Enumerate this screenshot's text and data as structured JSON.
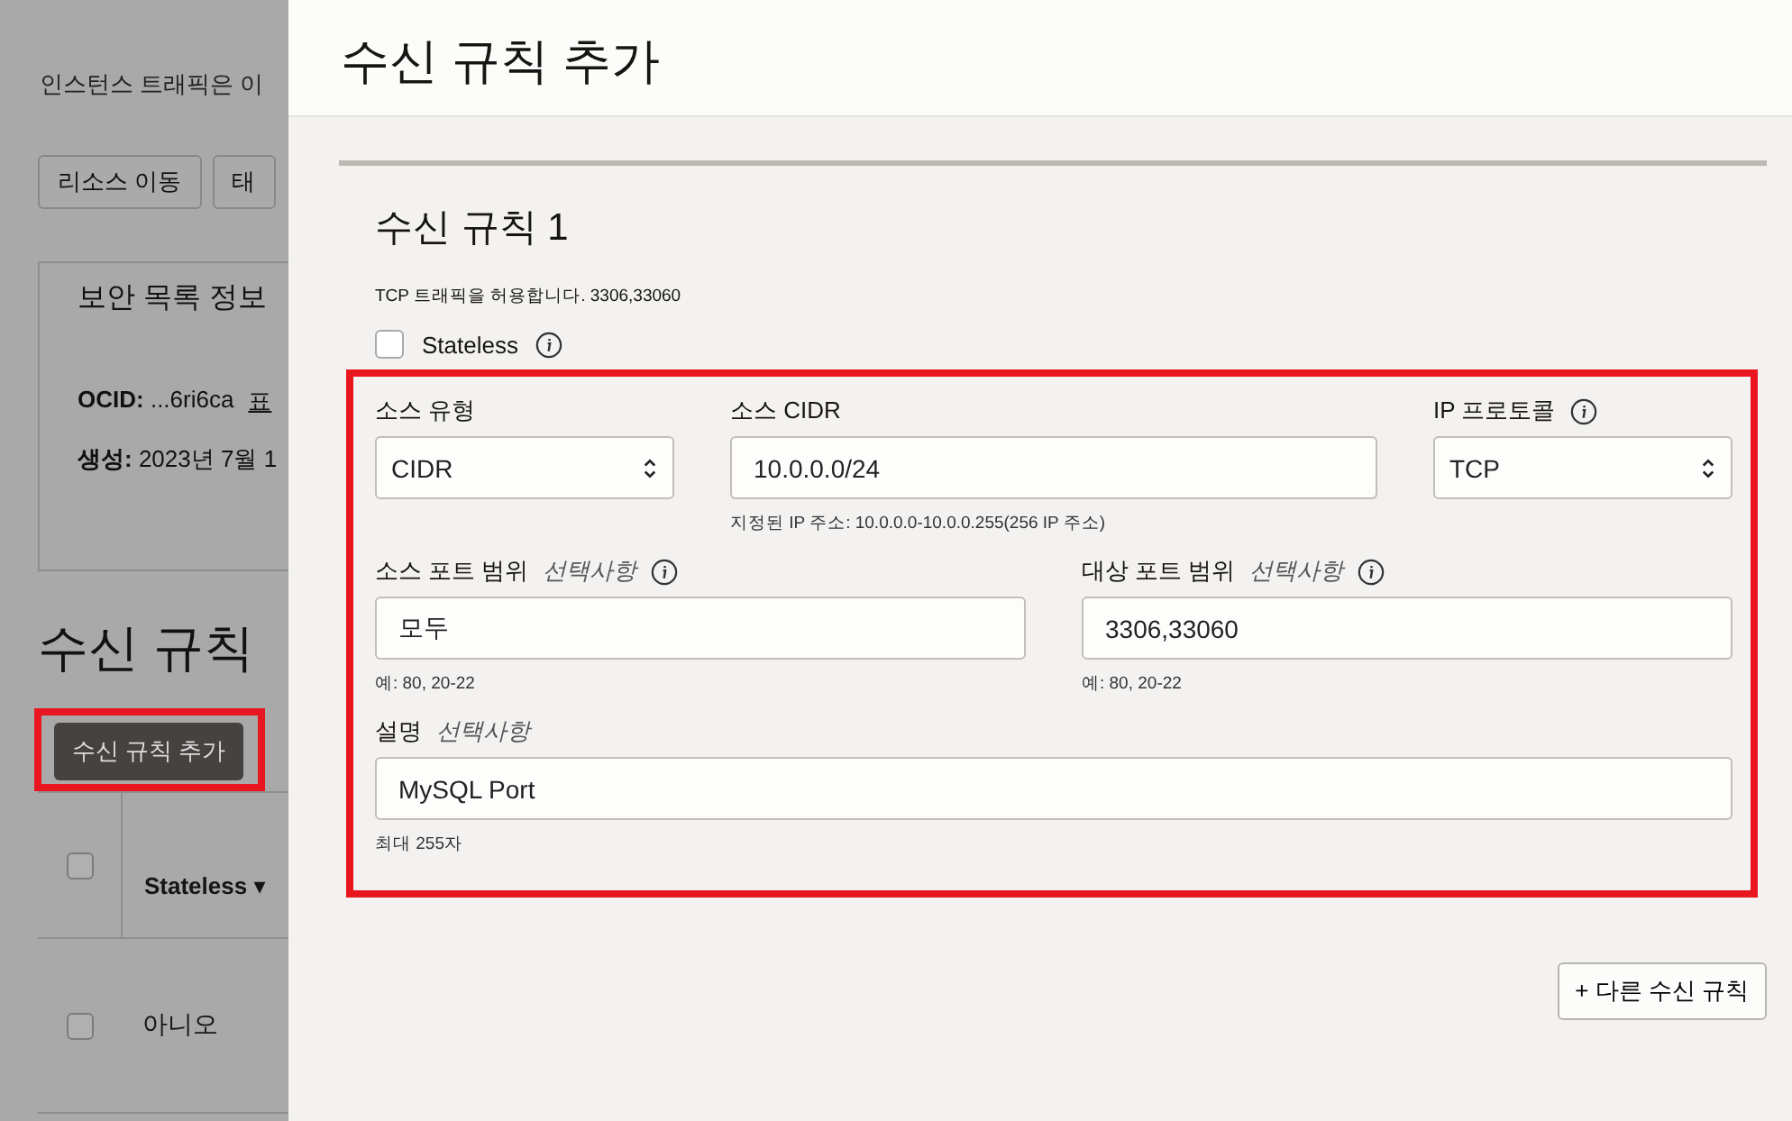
{
  "background_page": {
    "description": "인스턴스 트래픽은 이",
    "buttons": [
      "리소스 이동",
      "태"
    ],
    "info_card": {
      "title": "보안 목록 정보",
      "ocid": "**OCID:** ...6ri6ca",
      "ocid_link": "표",
      "created": "**생성:** 2023년 7월 1"
    },
    "section_title": "수신 규칙",
    "add_button": {
      "label": "수신 규칙 추가",
      "highlighted": true
    },
    "table": {
      "header_checkbox": {
        "checked": false
      },
      "columns": [
        "Stateless ▾"
      ],
      "rows": [
        {
          "checked": false,
          "cells": [
            "아니오"
          ]
        }
      ]
    }
  },
  "drawer": {
    "title": "수신 규칙 추가",
    "rule": {
      "title": "수신 규칙 1",
      "summary": "TCP 트래픽을 허용합니다. 3306,33060",
      "stateless": {
        "label": "Stateless",
        "checked": false
      },
      "fields_highlighted": true,
      "rows": [
        [
          {
            "kind": "select",
            "label": "소스 유형",
            "value": "CIDR",
            "info": false
          },
          {
            "kind": "input",
            "label": "소스 CIDR",
            "value": "10.0.0.0/24",
            "hint": "지정된 IP 주소: 10.0.0.0-10.0.0.255(256 IP 주소)",
            "info": false
          },
          {
            "kind": "select",
            "label": "IP 프로토콜",
            "value": "TCP",
            "info": true
          }
        ],
        [
          {
            "kind": "input",
            "label": "소스 포트 범위",
            "optional": "선택사항",
            "value": "모두",
            "hint": "예: 80, 20-22",
            "info": true
          },
          {
            "kind": "input",
            "label": "대상 포트 범위",
            "optional": "선택사항",
            "value": "3306,33060",
            "hint": "예: 80, 20-22",
            "info": true
          }
        ],
        [
          {
            "kind": "input",
            "label": "설명",
            "optional": "선택사항",
            "value": "MySQL Port",
            "hint": "최대 255자",
            "info": false
          }
        ]
      ]
    },
    "add_another_button": "+ 다른 수신 규칙"
  }
}
